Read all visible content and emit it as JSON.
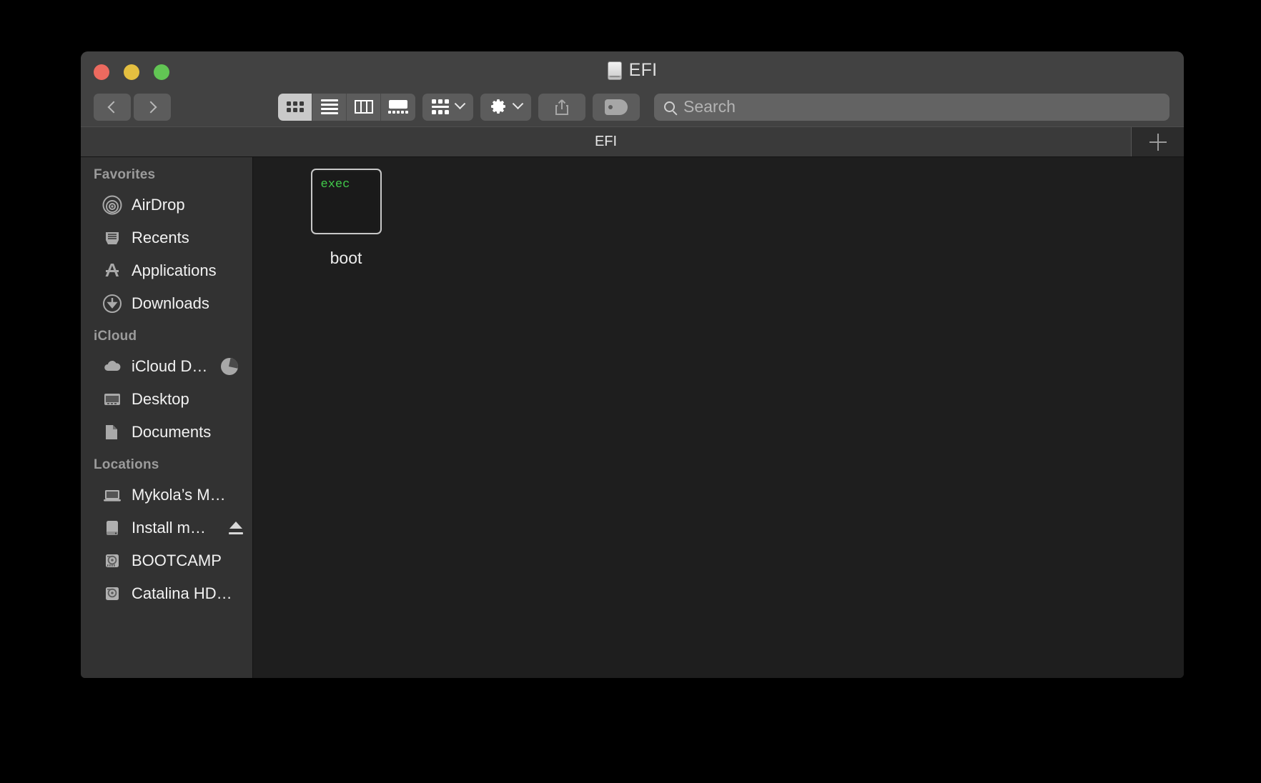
{
  "window": {
    "title": "EFI",
    "title_icon": "disk-icon",
    "traffic_lights": [
      {
        "name": "close",
        "color": "#ec6a5f"
      },
      {
        "name": "minimize",
        "color": "#e4bf40"
      },
      {
        "name": "maximize",
        "color": "#62c554"
      }
    ]
  },
  "toolbar": {
    "back_icon": "chevron-left-icon",
    "forward_icon": "chevron-right-icon",
    "view_modes": [
      {
        "name": "icon-view",
        "icon": "grid-icon",
        "active": true
      },
      {
        "name": "list-view",
        "icon": "list-icon",
        "active": false
      },
      {
        "name": "column-view",
        "icon": "columns-icon",
        "active": false
      },
      {
        "name": "gallery-view",
        "icon": "gallery-icon",
        "active": false
      }
    ],
    "arrange_icon": "arrange-icon",
    "action_icon": "gear-icon",
    "share_icon": "share-icon",
    "tag_icon": "tag-icon",
    "dropdown_icon": "chevron-down-icon"
  },
  "search": {
    "icon": "search-icon",
    "placeholder": "Search",
    "value": ""
  },
  "tabs": {
    "items": [
      {
        "label": "EFI",
        "active": true
      }
    ],
    "new_tab_icon": "plus-icon"
  },
  "sidebar": {
    "sections": [
      {
        "header": "Favorites",
        "items": [
          {
            "label": "AirDrop",
            "icon": "airdrop-icon",
            "badge": null,
            "eject": false
          },
          {
            "label": "Recents",
            "icon": "recents-icon",
            "badge": null,
            "eject": false
          },
          {
            "label": "Applications",
            "icon": "applications-icon",
            "badge": null,
            "eject": false
          },
          {
            "label": "Downloads",
            "icon": "downloads-icon",
            "badge": null,
            "eject": false
          }
        ]
      },
      {
        "header": "iCloud",
        "items": [
          {
            "label": "iCloud D…",
            "icon": "icloud-icon",
            "badge": "pie-progress",
            "eject": false
          },
          {
            "label": "Desktop",
            "icon": "desktop-icon",
            "badge": null,
            "eject": false
          },
          {
            "label": "Documents",
            "icon": "documents-icon",
            "badge": null,
            "eject": false
          }
        ]
      },
      {
        "header": "Locations",
        "items": [
          {
            "label": "Mykola’s M…",
            "icon": "laptop-icon",
            "badge": null,
            "eject": false
          },
          {
            "label": "Install m…",
            "icon": "external-disk-icon",
            "badge": null,
            "eject": true
          },
          {
            "label": "BOOTCAMP",
            "icon": "hard-disk-icon",
            "badge": null,
            "eject": false
          },
          {
            "label": "Catalina HD…",
            "icon": "hard-disk-icon",
            "badge": null,
            "eject": false
          }
        ]
      }
    ]
  },
  "content": {
    "items": [
      {
        "label": "boot",
        "icon": "unix-executable-icon",
        "icon_text": "exec"
      }
    ]
  },
  "colors": {
    "desktop": "#000000",
    "toolbar": "#424242",
    "tabbar": "#3a3a3a",
    "sidebar": "#323232",
    "content": "#1e1e1e",
    "exec_green": "#41c94a",
    "search_field": "#636363",
    "active_segment": "#c9c9c9"
  }
}
